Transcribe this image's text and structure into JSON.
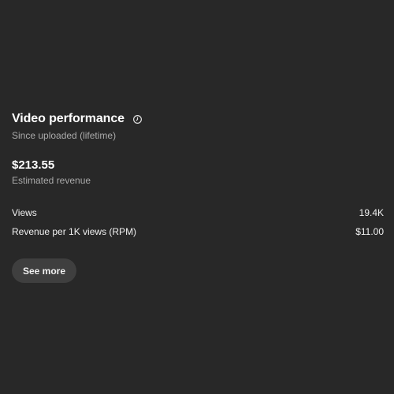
{
  "card": {
    "title": "Video performance",
    "info_icon": "clock-icon",
    "subtitle": "Since uploaded (lifetime)",
    "revenue": {
      "value": "$213.55",
      "label": "Estimated revenue"
    },
    "metrics": [
      {
        "label": "Views",
        "value": "19.4K"
      },
      {
        "label": "Revenue per 1K views (RPM)",
        "value": "$11.00"
      }
    ],
    "see_more_label": "See more"
  },
  "colors": {
    "background": "#282828",
    "primary_text": "#f1f1f1",
    "secondary_text": "#aaaaaa",
    "button_bg": "#3f3f3f"
  }
}
